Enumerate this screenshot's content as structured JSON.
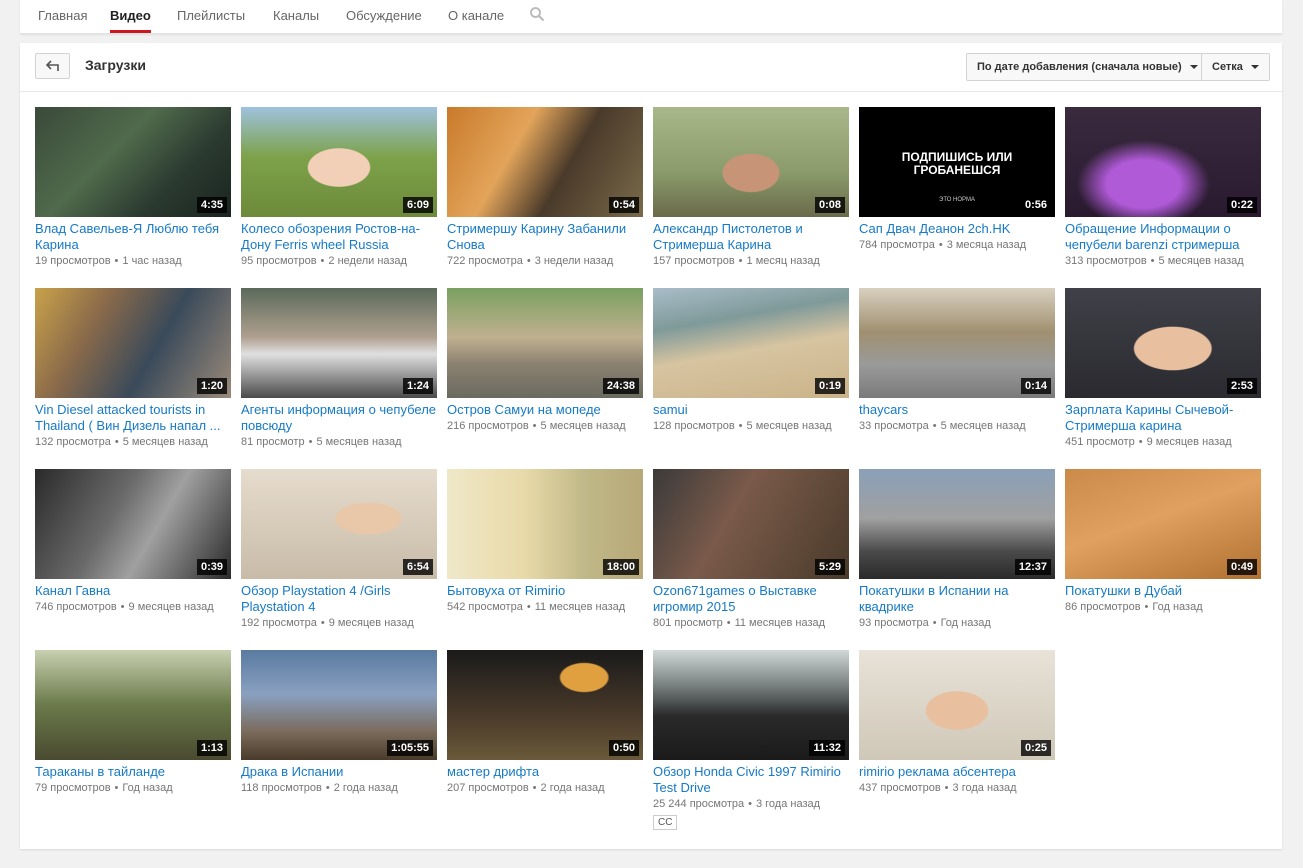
{
  "tabs": [
    {
      "label": "Главная"
    },
    {
      "label": "Видео",
      "active": true
    },
    {
      "label": "Плейлисты"
    },
    {
      "label": "Каналы"
    },
    {
      "label": "Обсуждение"
    },
    {
      "label": "О канале"
    }
  ],
  "header": {
    "title": "Загрузки",
    "sort_label": "По дате добавления (сначала новые)",
    "view_label": "Сетка"
  },
  "colors": {
    "link": "#167ac6",
    "accent": "#cc181e",
    "meta": "#767676"
  },
  "videos": [
    {
      "title": "Влад Савельев-Я Люблю тебя Карина",
      "duration": "4:35",
      "views": "19 просмотров",
      "ago": "1 час назад"
    },
    {
      "title": "Колесо обозрения Ростов-на-Дону Ferris wheel Russia",
      "duration": "6:09",
      "views": "95 просмотров",
      "ago": "2 недели назад"
    },
    {
      "title": "Стримершу Карину Забанили Снова",
      "duration": "0:54",
      "views": "722 просмотра",
      "ago": "3 недели назад"
    },
    {
      "title": "Александр Пистолетов и Стримерша Карина",
      "duration": "0:08",
      "views": "157 просмотров",
      "ago": "1 месяц назад"
    },
    {
      "title": "Сап Двач Деанон 2ch.HK",
      "duration": "0:56",
      "views": "784 просмотра",
      "ago": "3 месяца назад",
      "thumb_text": "ПОДПИШИСЬ ИЛИ ГРОБАНЕШСЯ",
      "thumb_small": "ЭТО НОРМА"
    },
    {
      "title": "Обращение Информации о чепубели barenzi стримерша",
      "duration": "0:22",
      "views": "313 просмотров",
      "ago": "5 месяцев назад"
    },
    {
      "title": "Vin Diesel attacked tourists in Thailand ( Вин Дизель напал ...",
      "duration": "1:20",
      "views": "132 просмотра",
      "ago": "5 месяцев назад"
    },
    {
      "title": "Агенты информация о чепубеле повсюду",
      "duration": "1:24",
      "views": "81 просмотр",
      "ago": "5 месяцев назад"
    },
    {
      "title": "Остров Самуи на мопеде",
      "duration": "24:38",
      "views": "216 просмотров",
      "ago": "5 месяцев назад"
    },
    {
      "title": "samui",
      "duration": "0:19",
      "views": "128 просмотров",
      "ago": "5 месяцев назад"
    },
    {
      "title": "thaycars",
      "duration": "0:14",
      "views": "33 просмотра",
      "ago": "5 месяцев назад"
    },
    {
      "title": "Зарплата Карины Сычевой-Стримерша карина",
      "duration": "2:53",
      "views": "451 просмотр",
      "ago": "9 месяцев назад"
    },
    {
      "title": "Канал Гавна",
      "duration": "0:39",
      "views": "746 просмотров",
      "ago": "9 месяцев назад"
    },
    {
      "title": "Обзор Playstation 4 /Girls Playstation 4",
      "duration": "6:54",
      "views": "192 просмотра",
      "ago": "9 месяцев назад"
    },
    {
      "title": "Бытовуха от Rimirio",
      "duration": "18:00",
      "views": "542 просмотра",
      "ago": "11 месяцев назад"
    },
    {
      "title": "Ozon671games о Выставке игромир 2015",
      "duration": "5:29",
      "views": "801 просмотр",
      "ago": "11 месяцев назад"
    },
    {
      "title": "Покатушки в Испании на квадрике",
      "duration": "12:37",
      "views": "93 просмотра",
      "ago": "Год назад"
    },
    {
      "title": "Покатушки в Дубай",
      "duration": "0:49",
      "views": "86 просмотров",
      "ago": "Год назад"
    },
    {
      "title": "Тараканы в тайланде",
      "duration": "1:13",
      "views": "79 просмотров",
      "ago": "Год назад"
    },
    {
      "title": "Драка в Испании",
      "duration": "1:05:55",
      "views": "118 просмотров",
      "ago": "2 года назад"
    },
    {
      "title": "мастер дрифта",
      "duration": "0:50",
      "views": "207 просмотров",
      "ago": "2 года назад"
    },
    {
      "title": "Обзор Honda Civic 1997 Rimirio Test Drive",
      "duration": "11:32",
      "views": "25 244 просмотра",
      "ago": "3 года назад",
      "badge": "CC"
    },
    {
      "title": "rimirio реклама абсентера",
      "duration": "0:25",
      "views": "437 просмотров",
      "ago": "3 года назад"
    }
  ]
}
